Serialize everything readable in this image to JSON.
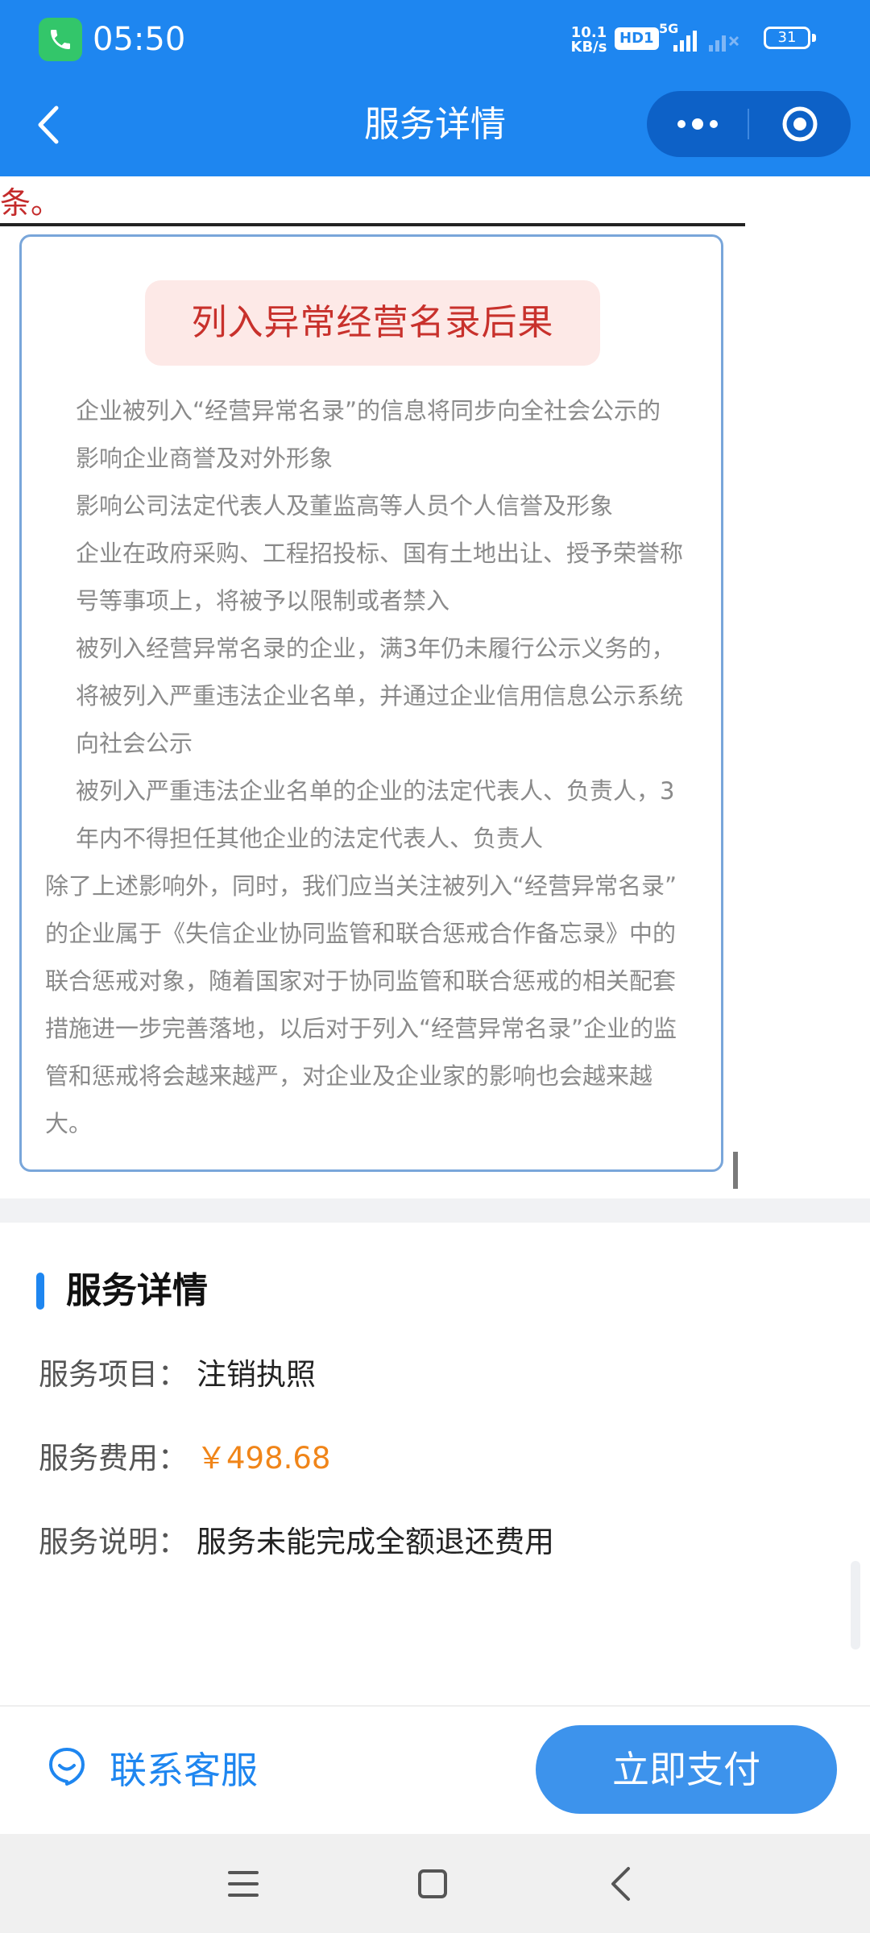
{
  "status_bar": {
    "time": "05:50",
    "net_speed_value": "10.1",
    "net_speed_unit": "KB/s",
    "hd_badge": "HD1",
    "network_type": "5G",
    "battery": "31"
  },
  "nav": {
    "title": "服务详情"
  },
  "content": {
    "truncated_text": "条。",
    "card_title": "列入异常经营名录后果",
    "card_lines": [
      "企业被列入“经营异常名录”的信息将同步向全社会公示的",
      "影响企业商誉及对外形象",
      "影响公司法定代表人及董监高等人员个人信誉及形象",
      "企业在政府采购、工程招投标、国有土地出让、授予荣誉称",
      "号等事项上，将被予以限制或者禁入",
      "被列入经营异常名录的企业，满3年仍未履行公示义务的，",
      "将被列入严重违法企业名单，并通过企业信用信息公示系统",
      "向社会公示",
      "被列入严重违法企业名单的企业的法定代表人、负责人，3",
      "年内不得担任其他企业的法定代表人、负责人"
    ],
    "card_paragraph_lines": [
      "除了上述影响外，同时，我们应当关注被列入“经营异常名录”",
      "的企业属于《失信企业协同监管和联合惩戒合作备忘录》中的",
      "联合惩戒对象，随着国家对于协同监管和联合惩戒的相关配套",
      "措施进一步完善落地，以后对于列入“经营异常名录”企业的监",
      "管和惩戒将会越来越严，对企业及企业家的影响也会越来越",
      "大。"
    ]
  },
  "service_details": {
    "section_title": "服务详情",
    "item_label": "服务项目：",
    "item_value": "注销执照",
    "fee_label": "服务费用：",
    "fee_value": "￥498.68",
    "desc_label": "服务说明：",
    "desc_value": "服务未能完成全额退还费用"
  },
  "bottom_bar": {
    "contact_label": "联系客服",
    "pay_label": "立即支付"
  },
  "colors": {
    "primary": "#1e86f0",
    "title_red": "#c8312c",
    "fee_orange": "#f08519"
  },
  "icons": [
    "phone-call-icon",
    "back-icon",
    "more-icon",
    "target-icon",
    "customer-service-icon",
    "menu-icon",
    "home-icon",
    "nav-back-icon"
  ]
}
